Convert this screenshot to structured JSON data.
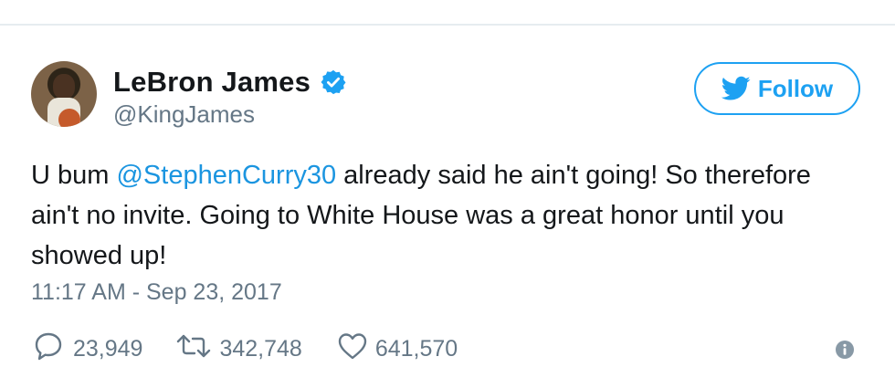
{
  "user": {
    "display_name": "LeBron James",
    "handle": "@KingJames"
  },
  "follow_button": {
    "label": "Follow",
    "icon": "twitter-bird-icon"
  },
  "tweet": {
    "segment_1": "U bum ",
    "mention": "@StephenCurry30",
    "segment_2": " already said he ain't going! So therefore ain't no invite. Going to White House was a great honor until you showed up!"
  },
  "timestamp": "11:17 AM - Sep 23, 2017",
  "actions": {
    "replies": "23,949",
    "retweets": "342,748",
    "likes": "641,570"
  },
  "colors": {
    "accent": "#1da1f2",
    "mention": "#1b95e0",
    "muted": "#657786",
    "text": "#14171a"
  }
}
